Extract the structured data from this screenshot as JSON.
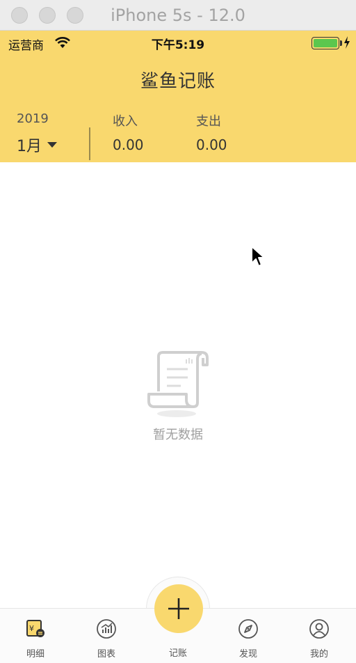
{
  "window": {
    "title": "iPhone 5s - 12.0"
  },
  "status_bar": {
    "carrier": "运营商",
    "time": "下午5:19",
    "battery_level": 1.0
  },
  "app": {
    "title": "鲨鱼记账"
  },
  "summary": {
    "year": "2019",
    "month": "1月",
    "income_label": "收入",
    "income_value": "0.00",
    "expense_label": "支出",
    "expense_value": "0.00"
  },
  "empty_state": {
    "text": "暂无数据",
    "icon": "receipt-scroll-icon"
  },
  "tabbar": {
    "items": [
      {
        "label": "明细",
        "icon": "ledger-icon",
        "active": true
      },
      {
        "label": "图表",
        "icon": "chart-icon",
        "active": false
      },
      {
        "label": "记账",
        "icon": "plus-icon",
        "active": false
      },
      {
        "label": "发现",
        "icon": "compass-icon",
        "active": false
      },
      {
        "label": "我的",
        "icon": "user-icon",
        "active": false
      }
    ]
  },
  "colors": {
    "accent": "#f9d86e",
    "text": "#333333",
    "muted": "#a0a0a0"
  }
}
